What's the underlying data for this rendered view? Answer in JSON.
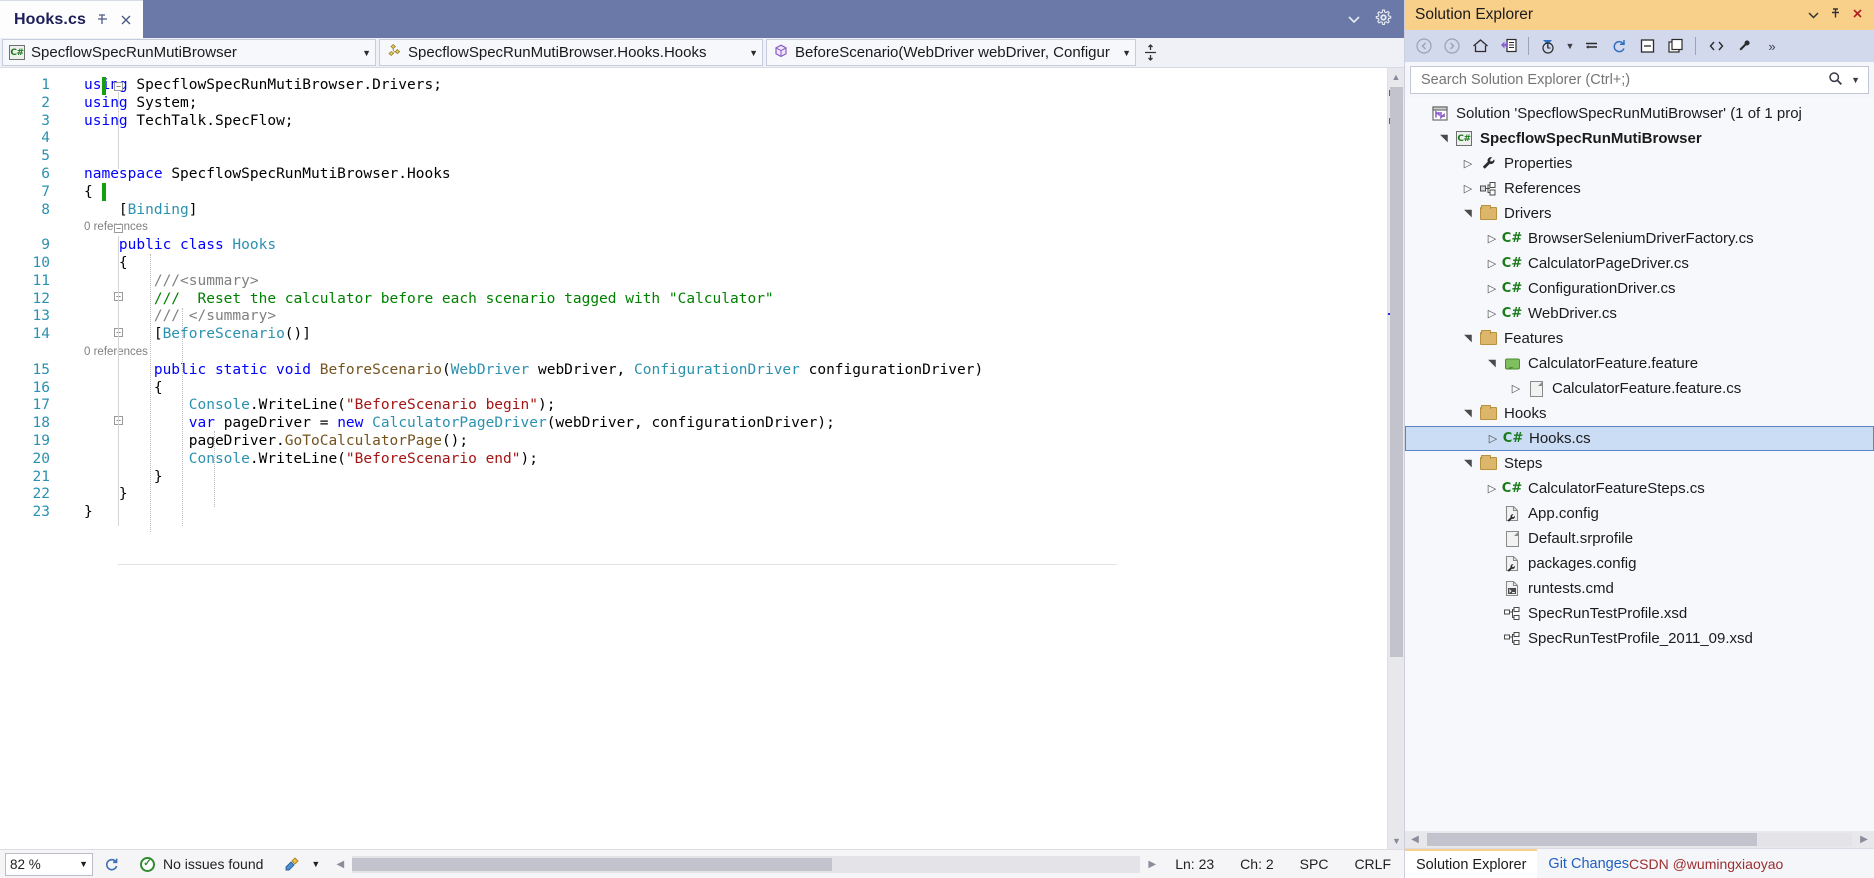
{
  "tab": {
    "title": "Hooks.cs",
    "pin_icon": "pin-icon",
    "close_icon": "close-icon"
  },
  "tabstrip_right": {
    "chevron_icon": "chevron-down-icon",
    "settings_icon": "gear-icon"
  },
  "navbar": {
    "project": "SpecflowSpecRunMutiBrowser",
    "type": "SpecflowSpecRunMutiBrowser.Hooks.Hooks",
    "member": "BeforeScenario(WebDriver webDriver, Configuratio",
    "split_icon": "split-window-icon",
    "caret": "▼"
  },
  "code": {
    "lines": [
      {
        "n": "1",
        "segs": [
          {
            "t": "using ",
            "c": "kw"
          },
          {
            "t": "SpecflowSpecRunMutiBrowser.Drivers;",
            "c": "pln"
          }
        ]
      },
      {
        "n": "2",
        "segs": [
          {
            "t": "using ",
            "c": "kw"
          },
          {
            "t": "System;",
            "c": "pln"
          }
        ]
      },
      {
        "n": "3",
        "segs": [
          {
            "t": "using ",
            "c": "kw"
          },
          {
            "t": "TechTalk.SpecFlow;",
            "c": "pln"
          }
        ]
      },
      {
        "n": "4",
        "segs": []
      },
      {
        "n": "5",
        "segs": []
      },
      {
        "n": "6",
        "segs": [
          {
            "t": "namespace ",
            "c": "kw"
          },
          {
            "t": "SpecflowSpecRunMutiBrowser.Hooks",
            "c": "pln"
          }
        ]
      },
      {
        "n": "7",
        "segs": [
          {
            "t": "{",
            "c": "pln"
          }
        ]
      },
      {
        "n": "8",
        "segs": [
          {
            "t": "    [",
            "c": "pln"
          },
          {
            "t": "Binding",
            "c": "typ"
          },
          {
            "t": "]",
            "c": "pln"
          }
        ]
      },
      {
        "n": "ref1",
        "ref": "0 references"
      },
      {
        "n": "9",
        "segs": [
          {
            "t": "    ",
            "c": "pln"
          },
          {
            "t": "public class ",
            "c": "kw"
          },
          {
            "t": "Hooks",
            "c": "typ"
          }
        ]
      },
      {
        "n": "10",
        "segs": [
          {
            "t": "    {",
            "c": "pln"
          }
        ]
      },
      {
        "n": "11",
        "segs": [
          {
            "t": "        ///<summary>",
            "c": "doc"
          }
        ]
      },
      {
        "n": "12",
        "segs": [
          {
            "t": "        ///  Reset the calculator before each scenario tagged with \"Calculator\"",
            "c": "cmt"
          }
        ]
      },
      {
        "n": "13",
        "segs": [
          {
            "t": "        /// </summary>",
            "c": "doc"
          }
        ]
      },
      {
        "n": "14",
        "segs": [
          {
            "t": "        [",
            "c": "pln"
          },
          {
            "t": "BeforeScenario",
            "c": "typ"
          },
          {
            "t": "()]",
            "c": "pln"
          }
        ]
      },
      {
        "n": "ref2",
        "ref": "0 references"
      },
      {
        "n": "15",
        "segs": [
          {
            "t": "        ",
            "c": "pln"
          },
          {
            "t": "public static void ",
            "c": "kw"
          },
          {
            "t": "BeforeScenario",
            "c": "mthd"
          },
          {
            "t": "(",
            "c": "pln"
          },
          {
            "t": "WebDriver",
            "c": "typ"
          },
          {
            "t": " webDriver, ",
            "c": "pln"
          },
          {
            "t": "ConfigurationDriver",
            "c": "typ"
          },
          {
            "t": " configurationDriver)",
            "c": "pln"
          }
        ]
      },
      {
        "n": "16",
        "segs": [
          {
            "t": "        {",
            "c": "pln"
          }
        ]
      },
      {
        "n": "17",
        "segs": [
          {
            "t": "            ",
            "c": "pln"
          },
          {
            "t": "Console",
            "c": "typ"
          },
          {
            "t": ".WriteLine(",
            "c": "pln"
          },
          {
            "t": "\"BeforeScenario begin\"",
            "c": "str"
          },
          {
            "t": ");",
            "c": "pln"
          }
        ]
      },
      {
        "n": "18",
        "segs": [
          {
            "t": "            ",
            "c": "pln"
          },
          {
            "t": "var",
            "c": "kw"
          },
          {
            "t": " pageDriver = ",
            "c": "pln"
          },
          {
            "t": "new",
            "c": "kw"
          },
          {
            "t": " ",
            "c": "pln"
          },
          {
            "t": "CalculatorPageDriver",
            "c": "typ"
          },
          {
            "t": "(webDriver, configurationDriver);",
            "c": "pln"
          }
        ]
      },
      {
        "n": "19",
        "segs": [
          {
            "t": "            pageDriver.",
            "c": "pln"
          },
          {
            "t": "GoToCalculatorPage",
            "c": "mthd"
          },
          {
            "t": "();",
            "c": "pln"
          }
        ]
      },
      {
        "n": "20",
        "segs": [
          {
            "t": "            ",
            "c": "pln"
          },
          {
            "t": "Console",
            "c": "typ"
          },
          {
            "t": ".WriteLine(",
            "c": "pln"
          },
          {
            "t": "\"BeforeScenario end\"",
            "c": "str"
          },
          {
            "t": ");",
            "c": "pln"
          }
        ]
      },
      {
        "n": "21",
        "segs": [
          {
            "t": "        }",
            "c": "pln"
          }
        ]
      },
      {
        "n": "22",
        "segs": [
          {
            "t": "    }",
            "c": "pln"
          }
        ]
      },
      {
        "n": "23",
        "segs": [
          {
            "t": "}",
            "c": "pln"
          }
        ]
      }
    ]
  },
  "status": {
    "zoom": "82 %",
    "issues": "No issues found",
    "issues_icon": "check-circle-icon",
    "refresh_icon": "refresh-icon",
    "brush_icon": "brush-icon",
    "line": "Ln: 23",
    "col": "Ch: 2",
    "spaces": "SPC",
    "eol": "CRLF"
  },
  "solution_explorer": {
    "title": "Solution Explorer",
    "header_icons": [
      "chevron-down-icon",
      "pin-icon",
      "close-icon"
    ],
    "toolbar_icons": [
      "back-arrow-icon",
      "forward-arrow-icon",
      "home-icon",
      "sync-with-active-document-icon",
      "filter-icon",
      "pending-changes-icon",
      "collapse-all-icon",
      "refresh-icon",
      "show-all-files-icon",
      "properties-window-icon",
      "view-code-icon",
      "properties-icon",
      "overflow-icon"
    ],
    "search_placeholder": "Search Solution Explorer (Ctrl+;)",
    "search_icon": "search-icon",
    "search_caret_icon": "chevron-down-icon",
    "tree": [
      {
        "label": "Solution 'SpecflowSpecRunMutiBrowser' (1 of 1 proj",
        "indent": 0,
        "exp": "",
        "icon": "solution-icon",
        "bold": false,
        "selected": false
      },
      {
        "label": "SpecflowSpecRunMutiBrowser",
        "indent": 1,
        "exp": "▲",
        "icon": "csproj-icon",
        "bold": true,
        "selected": false
      },
      {
        "label": "Properties",
        "indent": 2,
        "exp": "▶",
        "icon": "wrench-icon",
        "bold": false,
        "selected": false
      },
      {
        "label": "References",
        "indent": 2,
        "exp": "▶",
        "icon": "references-icon",
        "bold": false,
        "selected": false
      },
      {
        "label": "Drivers",
        "indent": 2,
        "exp": "▲",
        "icon": "folder-icon",
        "bold": false,
        "selected": false
      },
      {
        "label": "BrowserSeleniumDriverFactory.cs",
        "indent": 3,
        "exp": "▶",
        "icon": "csharp-icon",
        "bold": false,
        "selected": false
      },
      {
        "label": "CalculatorPageDriver.cs",
        "indent": 3,
        "exp": "▶",
        "icon": "csharp-icon",
        "bold": false,
        "selected": false
      },
      {
        "label": "ConfigurationDriver.cs",
        "indent": 3,
        "exp": "▶",
        "icon": "csharp-icon",
        "bold": false,
        "selected": false
      },
      {
        "label": "WebDriver.cs",
        "indent": 3,
        "exp": "▶",
        "icon": "csharp-icon",
        "bold": false,
        "selected": false
      },
      {
        "label": "Features",
        "indent": 2,
        "exp": "▲",
        "icon": "folder-icon",
        "bold": false,
        "selected": false
      },
      {
        "label": "CalculatorFeature.feature",
        "indent": 3,
        "exp": "▲",
        "icon": "feature-icon",
        "bold": false,
        "selected": false
      },
      {
        "label": "CalculatorFeature.feature.cs",
        "indent": 4,
        "exp": "▶",
        "icon": "file-icon",
        "bold": false,
        "selected": false
      },
      {
        "label": "Hooks",
        "indent": 2,
        "exp": "▲",
        "icon": "folder-icon",
        "bold": false,
        "selected": false
      },
      {
        "label": "Hooks.cs",
        "indent": 3,
        "exp": "▶",
        "icon": "csharp-icon",
        "bold": false,
        "selected": true
      },
      {
        "label": "Steps",
        "indent": 2,
        "exp": "▲",
        "icon": "folder-icon",
        "bold": false,
        "selected": false
      },
      {
        "label": "CalculatorFeatureSteps.cs",
        "indent": 3,
        "exp": "▶",
        "icon": "csharp-icon",
        "bold": false,
        "selected": false
      },
      {
        "label": "App.config",
        "indent": 3,
        "exp": "",
        "icon": "config-icon",
        "bold": false,
        "selected": false
      },
      {
        "label": "Default.srprofile",
        "indent": 3,
        "exp": "",
        "icon": "file-icon",
        "bold": false,
        "selected": false
      },
      {
        "label": "packages.config",
        "indent": 3,
        "exp": "",
        "icon": "config-icon",
        "bold": false,
        "selected": false
      },
      {
        "label": "runtests.cmd",
        "indent": 3,
        "exp": "",
        "icon": "cmd-icon",
        "bold": false,
        "selected": false
      },
      {
        "label": "SpecRunTestProfile.xsd",
        "indent": 3,
        "exp": "",
        "icon": "xsd-icon",
        "bold": false,
        "selected": false
      },
      {
        "label": "SpecRunTestProfile_2011_09.xsd",
        "indent": 3,
        "exp": "",
        "icon": "xsd-icon",
        "bold": false,
        "selected": false
      }
    ],
    "bottom_tabs": [
      {
        "label": "Solution Explorer",
        "active": true
      },
      {
        "label": "Git Changes",
        "active": false
      }
    ],
    "watermark": "CSDN @wumingxiaoyao"
  }
}
